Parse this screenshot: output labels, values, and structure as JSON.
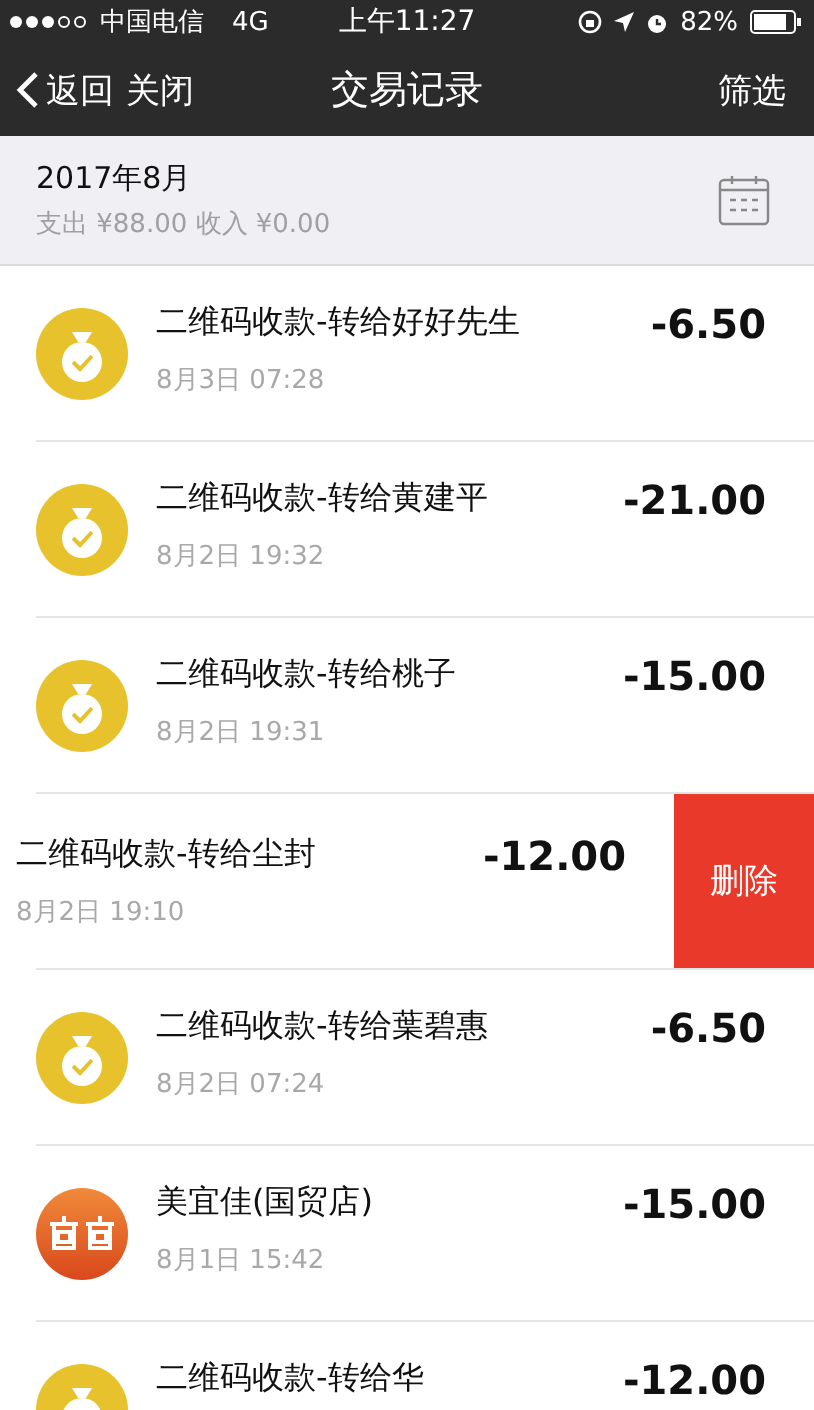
{
  "status_bar": {
    "carrier": "中国电信",
    "network": "4G",
    "time": "上午11:27",
    "battery": "82%"
  },
  "nav": {
    "back": "返回",
    "close": "关闭",
    "title": "交易记录",
    "filter": "筛选"
  },
  "month_header": {
    "month": "2017年8月",
    "summary": "支出 ¥88.00 收入 ¥0.00"
  },
  "transactions": [
    {
      "kind": "qr",
      "title": "二维码收款-转给好好先生",
      "date": "8月3日 07:28",
      "amount": "-6.50",
      "swiped": false
    },
    {
      "kind": "qr",
      "title": "二维码收款-转给黄建平",
      "date": "8月2日 19:32",
      "amount": "-21.00",
      "swiped": false
    },
    {
      "kind": "qr",
      "title": "二维码收款-转给桃子",
      "date": "8月2日 19:31",
      "amount": "-15.00",
      "swiped": false
    },
    {
      "title": "二维码收款-转给尘封",
      "date": "8月2日 19:10",
      "amount": "-12.00",
      "swiped": true,
      "delete_label": "删除"
    },
    {
      "kind": "qr",
      "title": "二维码收款-转给葉碧惠",
      "date": "8月2日 07:24",
      "amount": "-6.50",
      "swiped": false
    },
    {
      "kind": "store",
      "title": "美宜佳(国贸店)",
      "date": "8月1日 15:42",
      "amount": "-15.00",
      "swiped": false
    },
    {
      "kind": "qr",
      "title": "二维码收款-转给华",
      "amount": "-12.00",
      "swiped": false
    }
  ]
}
